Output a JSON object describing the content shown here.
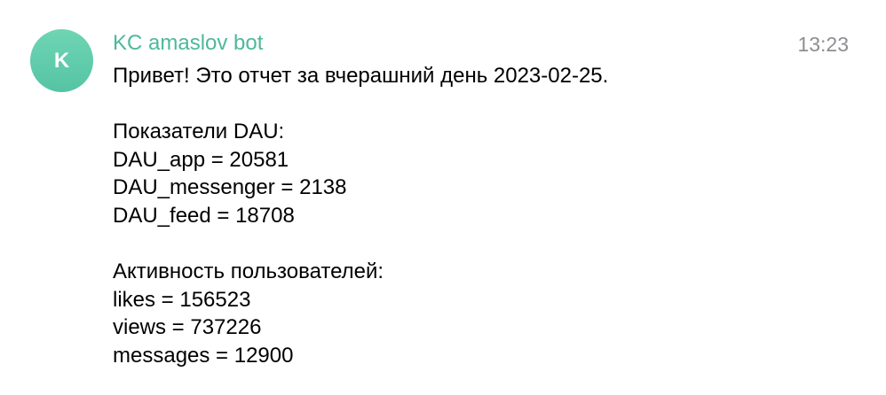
{
  "message": {
    "avatar_letter": "K",
    "avatar_color": "#5ccaa8",
    "sender": "KC amaslov bot",
    "sender_color": "#4fb89a",
    "time": "13:23",
    "lines": [
      "Привет! Это отчет за вчерашний день 2023-02-25.",
      "",
      "Показатели DAU:",
      "DAU_app = 20581",
      "DAU_messenger = 2138",
      "DAU_feed = 18708",
      "",
      "Активность пользователей:",
      "likes = 156523",
      "views = 737226",
      "messages = 12900"
    ]
  }
}
